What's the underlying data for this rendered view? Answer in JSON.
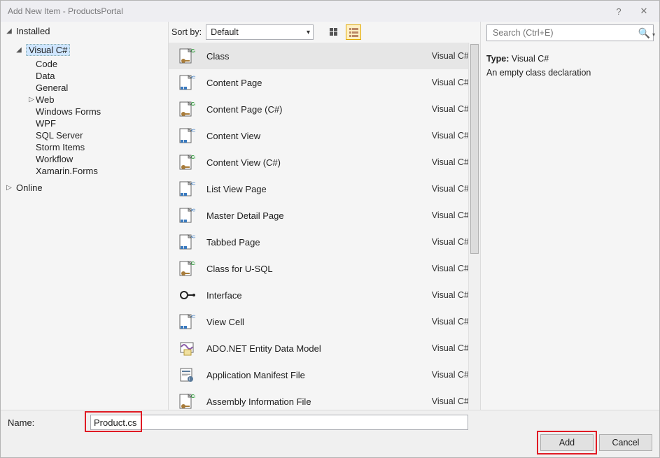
{
  "titlebar": {
    "title": "Add New Item - ProductsPortal",
    "help": "?",
    "close": "✕"
  },
  "sidebar": {
    "installed_label": "Installed",
    "online_label": "Online",
    "vc_label": "Visual C#",
    "items": [
      "Code",
      "Data",
      "General",
      "Web",
      "Windows Forms",
      "WPF",
      "SQL Server",
      "Storm Items",
      "Workflow",
      "Xamarin.Forms"
    ]
  },
  "topbar": {
    "sort_label": "Sort by:",
    "sort_value": "Default"
  },
  "search": {
    "placeholder": "Search (Ctrl+E)"
  },
  "details": {
    "type_label": "Type:",
    "type_value": "Visual C#",
    "description": "An empty class declaration"
  },
  "list": {
    "group": "Visual C#",
    "items": [
      {
        "name": "Class",
        "icon": "csfile"
      },
      {
        "name": "Content Page",
        "icon": "xfile"
      },
      {
        "name": "Content Page (C#)",
        "icon": "csfile"
      },
      {
        "name": "Content View",
        "icon": "xfile"
      },
      {
        "name": "Content View (C#)",
        "icon": "csfile"
      },
      {
        "name": "List View Page",
        "icon": "xfile"
      },
      {
        "name": "Master Detail Page",
        "icon": "xfile"
      },
      {
        "name": "Tabbed Page",
        "icon": "xfile"
      },
      {
        "name": "Class for U-SQL",
        "icon": "csfile"
      },
      {
        "name": "Interface",
        "icon": "interface"
      },
      {
        "name": "View Cell",
        "icon": "xfile"
      },
      {
        "name": "ADO.NET Entity Data Model",
        "icon": "entity"
      },
      {
        "name": "Application Manifest File",
        "icon": "manifest"
      },
      {
        "name": "Assembly Information File",
        "icon": "csfile"
      }
    ]
  },
  "bottom": {
    "name_label": "Name:",
    "name_value": "Product.cs",
    "add_label": "Add",
    "cancel_label": "Cancel"
  }
}
